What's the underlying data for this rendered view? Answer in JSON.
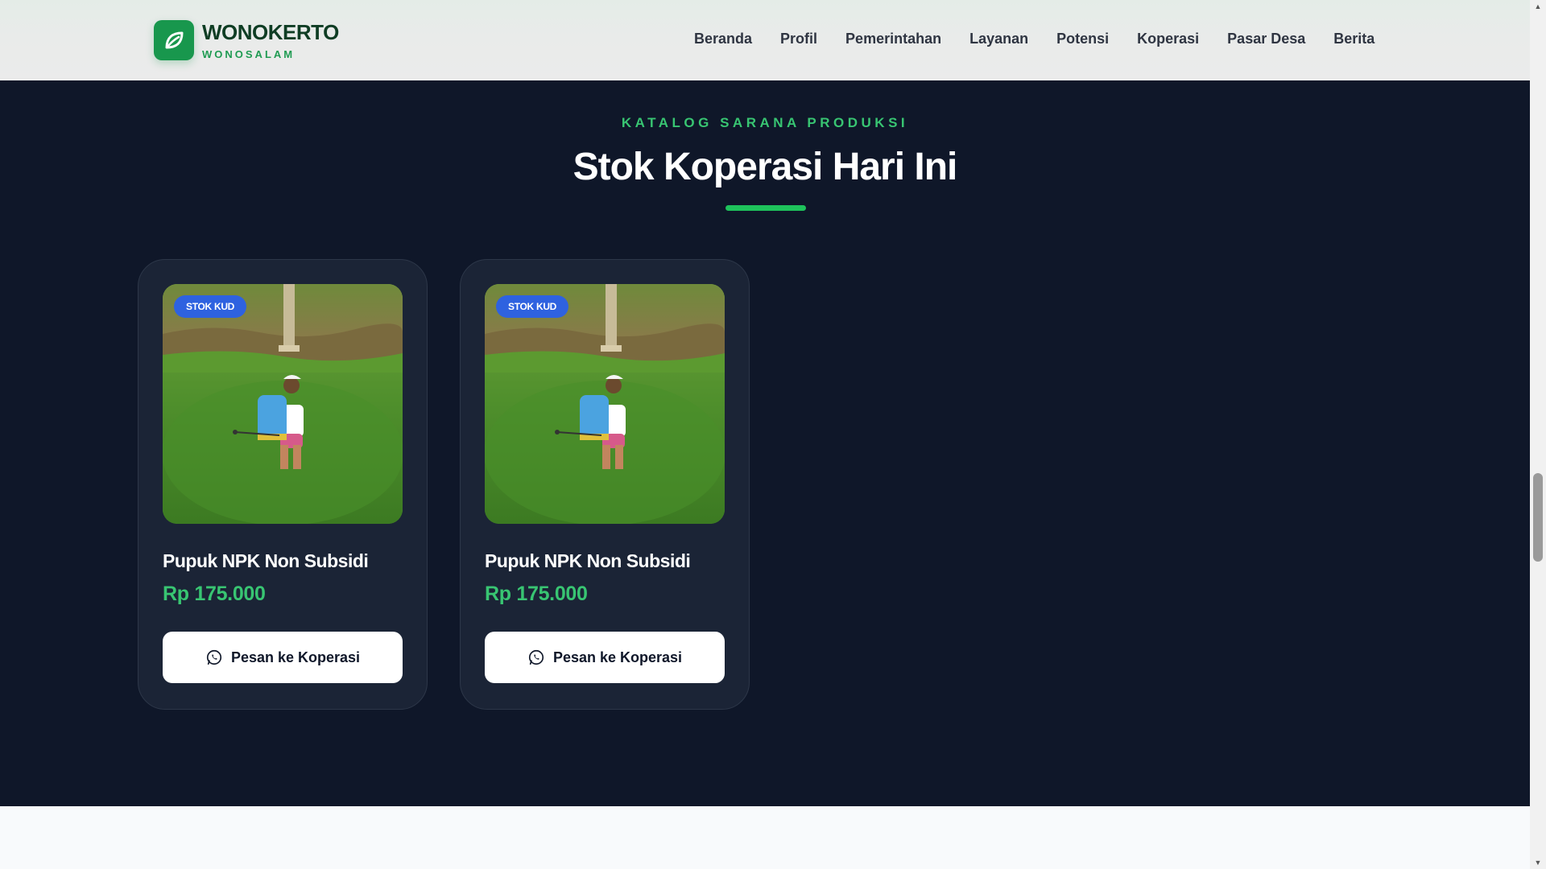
{
  "header": {
    "brand_name": "WONOKERTO",
    "brand_sub": "WONOSALAM",
    "logo_icon": "leaf-icon",
    "nav": [
      {
        "label": "Beranda"
      },
      {
        "label": "Profil"
      },
      {
        "label": "Pemerintahan"
      },
      {
        "label": "Layanan"
      },
      {
        "label": "Potensi"
      },
      {
        "label": "Koperasi"
      },
      {
        "label": "Pasar Desa"
      },
      {
        "label": "Berita"
      }
    ]
  },
  "section": {
    "eyebrow": "KATALOG SARANA PRODUKSI",
    "title": "Stok Koperasi Hari Ini"
  },
  "products": [
    {
      "badge": "STOK KUD",
      "name": "Pupuk NPK Non Subsidi",
      "price": "Rp 175.000",
      "button_label": "Pesan ke Koperasi",
      "button_icon": "whatsapp-icon"
    },
    {
      "badge": "STOK KUD",
      "name": "Pupuk NPK Non Subsidi",
      "price": "Rp 175.000",
      "button_label": "Pesan ke Koperasi",
      "button_icon": "whatsapp-icon"
    }
  ],
  "colors": {
    "brand_green": "#18974d",
    "accent_green": "#38c572",
    "badge_blue": "#2e62e0",
    "section_bg": "#0f1729",
    "card_bg": "#1b2436"
  }
}
